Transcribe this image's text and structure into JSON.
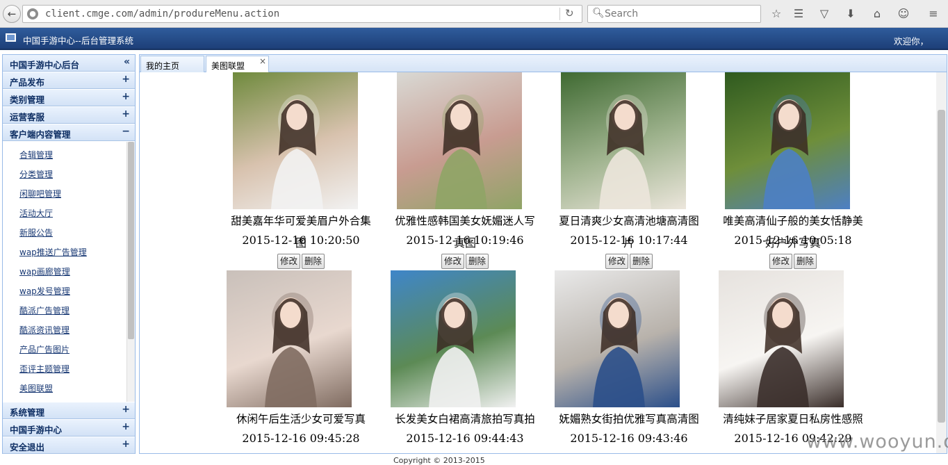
{
  "browser": {
    "url": "client.cmge.com/admin/produreMenu.action",
    "search_placeholder": "Search",
    "back_icon": "back-arrow-icon",
    "globe_icon": "globe-icon",
    "reload_icon": "reload-icon"
  },
  "header": {
    "title": "中国手游中心--后台管理系统",
    "welcome": "欢迎你，"
  },
  "sidebar": {
    "top_panel": {
      "label": "中国手游中心后台",
      "tool": "«"
    },
    "sections": [
      {
        "label": "产品发布",
        "tool": "+"
      },
      {
        "label": "类别管理",
        "tool": "+"
      },
      {
        "label": "运营客服",
        "tool": "+"
      },
      {
        "label": "客户端内容管理",
        "tool": "−"
      }
    ],
    "items": [
      "合辑管理",
      "分类管理",
      "闲聊吧管理",
      "活动大厅",
      "新服公告",
      "wap推送广告管理",
      "wap画廊管理",
      "wap发号管理",
      "酷派广告管理",
      "酷派资讯管理",
      "产品广告图片",
      "歪评主题管理",
      "美图联盟"
    ],
    "bottom_sections": [
      {
        "label": "系统管理",
        "tool": "+"
      },
      {
        "label": "中国手游中心",
        "tool": "+"
      },
      {
        "label": "安全退出",
        "tool": "+"
      }
    ]
  },
  "tabs": [
    {
      "label": "我的主页"
    },
    {
      "label": "美图联盟",
      "close": "×"
    }
  ],
  "buttons": {
    "edit": "修改",
    "delete": "删除"
  },
  "photos": [
    {
      "title": "甜美嘉年华可爱美眉户外合集",
      "date": "2015-12-16 10:20:50",
      "overlay": "图",
      "colors": [
        "#6f8a3d",
        "#d8c2ae",
        "#f2f2f2"
      ]
    },
    {
      "title": "优雅性感韩国美女妩媚迷人写",
      "date": "2015-12-16 10:19:46",
      "overlay": "真图",
      "colors": [
        "#d9d9d4",
        "#c89c91",
        "#8fa466"
      ]
    },
    {
      "title": "夏日清爽少女高清池塘高清图",
      "date": "2015-12-16 10:17:44",
      "overlay": "片",
      "colors": [
        "#3f6a32",
        "#9fb38e",
        "#ece6dc"
      ]
    },
    {
      "title": "唯美高清仙子般的美女恬静美",
      "date": "2015-12-16 10:05:18",
      "overlay": "好户外写真",
      "colors": [
        "#2f5a1f",
        "#6e8e3a",
        "#4d7fc4"
      ]
    },
    {
      "title": "休闲午后生活少女可爱写真",
      "date": "2015-12-16 09:45:28",
      "overlay": "",
      "colors": [
        "#c9c0ba",
        "#e8d8cf",
        "#7f6b60"
      ]
    },
    {
      "title": "长发美女白裙高清旅拍写真拍",
      "date": "2015-12-16 09:44:43",
      "overlay": "",
      "colors": [
        "#3f86c9",
        "#5c8a55",
        "#f1f1f1"
      ]
    },
    {
      "title": "妩媚熟女街拍优雅写真高清图",
      "date": "2015-12-16 09:43:46",
      "overlay": "",
      "colors": [
        "#e9e9e9",
        "#b8b2ab",
        "#2b4f8a"
      ]
    },
    {
      "title": "清纯妹子居家夏日私房性感照",
      "date": "2015-12-16 09:42:29",
      "overlay": "",
      "colors": [
        "#e6e2de",
        "#f7f5f2",
        "#3a2e2a"
      ]
    }
  ],
  "footer": {
    "text": "Copyright © 2013-2015"
  },
  "watermark": "www.wooyun.org"
}
